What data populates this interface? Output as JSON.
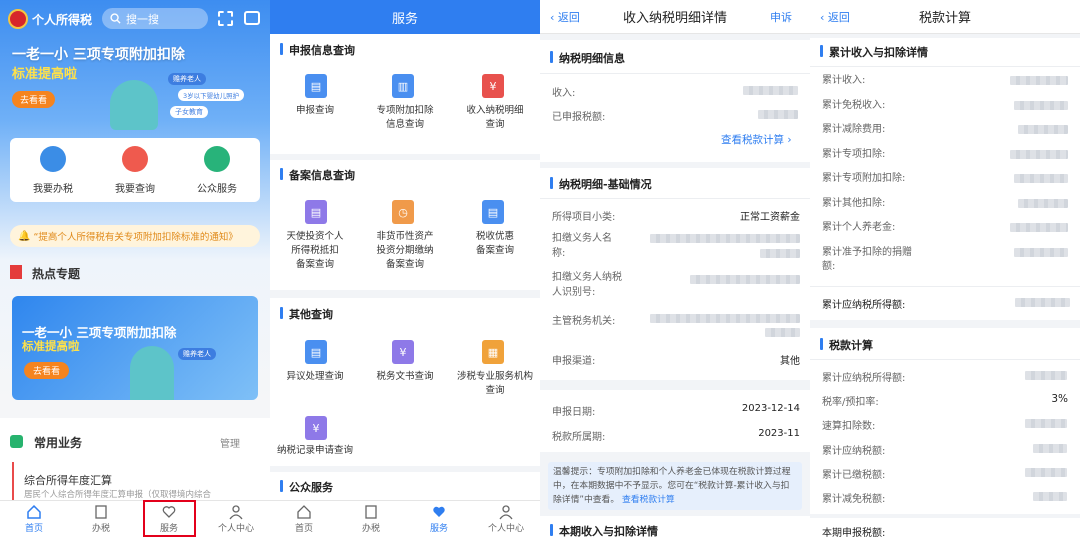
{
  "p1": {
    "app_title": "个人所得税",
    "search_placeholder": "搜一搜",
    "banner_title": "一老一小 三项专项附加扣除",
    "banner_sub": "标准提高啦",
    "banner_btn": "去看看",
    "banner_tags": [
      "赡养老人",
      "3岁以下婴幼儿照护",
      "子女教育"
    ],
    "quick": [
      "我要办税",
      "我要查询",
      "公众服务"
    ],
    "notice": "“提高个人所得税有关专项附加扣除标准的通知》",
    "hot_title": "热点专题",
    "common_title": "常用业务",
    "manage_label": "管理",
    "annual_title": "综合所得年度汇算",
    "annual_sub": "居民个人综合所得年度汇算申报（仅取得境内综合",
    "tabs": [
      "首页",
      "办税",
      "服务",
      "个人中心"
    ]
  },
  "p2": {
    "title": "服务",
    "sections": [
      "申报信息查询",
      "备案信息查询",
      "其他查询",
      "公众服务"
    ],
    "items_a": [
      "申报查询",
      "专项附加扣除\n信息查询",
      "收入纳税明细\n查询"
    ],
    "items_b": [
      "天使投资个人\n所得税抵扣\n备案查询",
      "非货币性资产\n投资分期缴纳\n备案查询",
      "税收优惠\n备案查询"
    ],
    "items_c": [
      "异议处理查询",
      "税务文书查询",
      "涉税专业服务机构\n查询"
    ],
    "item_d": "纳税记录申请查询",
    "tabs": [
      "首页",
      "办税",
      "服务",
      "个人中心"
    ]
  },
  "p3": {
    "back": "返回",
    "title": "收入纳税明细详情",
    "appeal": "申诉",
    "sec1": "纳税明细信息",
    "income_label": "收入:",
    "declared_tax_label": "已申报税额:",
    "view_calc": "查看税款计算",
    "sec2": "纳税明细-基础情况",
    "subcategory_label": "所得项目小类:",
    "subcategory_value": "正常工资薪金",
    "withholder_name_label": "扣缴义务人名\n称:",
    "withholder_id_label": "扣缴义务人纳税\n人识别号:",
    "tax_office_label": "主管税务机关:",
    "channel_label": "申报渠道:",
    "channel_value": "其他",
    "decl_date_label": "申报日期:",
    "decl_date_value": "2023-12-14",
    "period_label": "税款所属期:",
    "period_value": "2023-11",
    "tip": "温馨提示：专项附加扣除和个人养老金已体现在税款计算过程中，在本期数据中不予显示。您可在“税款计算-累计收入与扣除详情”中查看。",
    "tip_link": "查看税款计算",
    "sec3": "本期收入与扣除详情"
  },
  "p4": {
    "back": "返回",
    "title": "税款计算",
    "sec1": "累计收入与扣除详情",
    "rows1": [
      "累计收入:",
      "累计免税收入:",
      "累计减除费用:",
      "累计专项扣除:",
      "累计专项附加扣除:",
      "累计其他扣除:",
      "累计个人养老金:",
      "累计准予扣除的捐赠\n额:"
    ],
    "taxable_label": "累计应纳税所得额:",
    "sec2": "税款计算",
    "rows2": [
      "累计应纳税所得额:",
      "税率/预扣率:",
      "速算扣除数:",
      "累计应纳税额:",
      "累计已缴税额:",
      "累计减免税额:"
    ],
    "rate_value": "3%",
    "current_label": "本期申报税额:"
  },
  "colors": {
    "brand": "#2f7ef0",
    "highlight": "#e3001b"
  }
}
